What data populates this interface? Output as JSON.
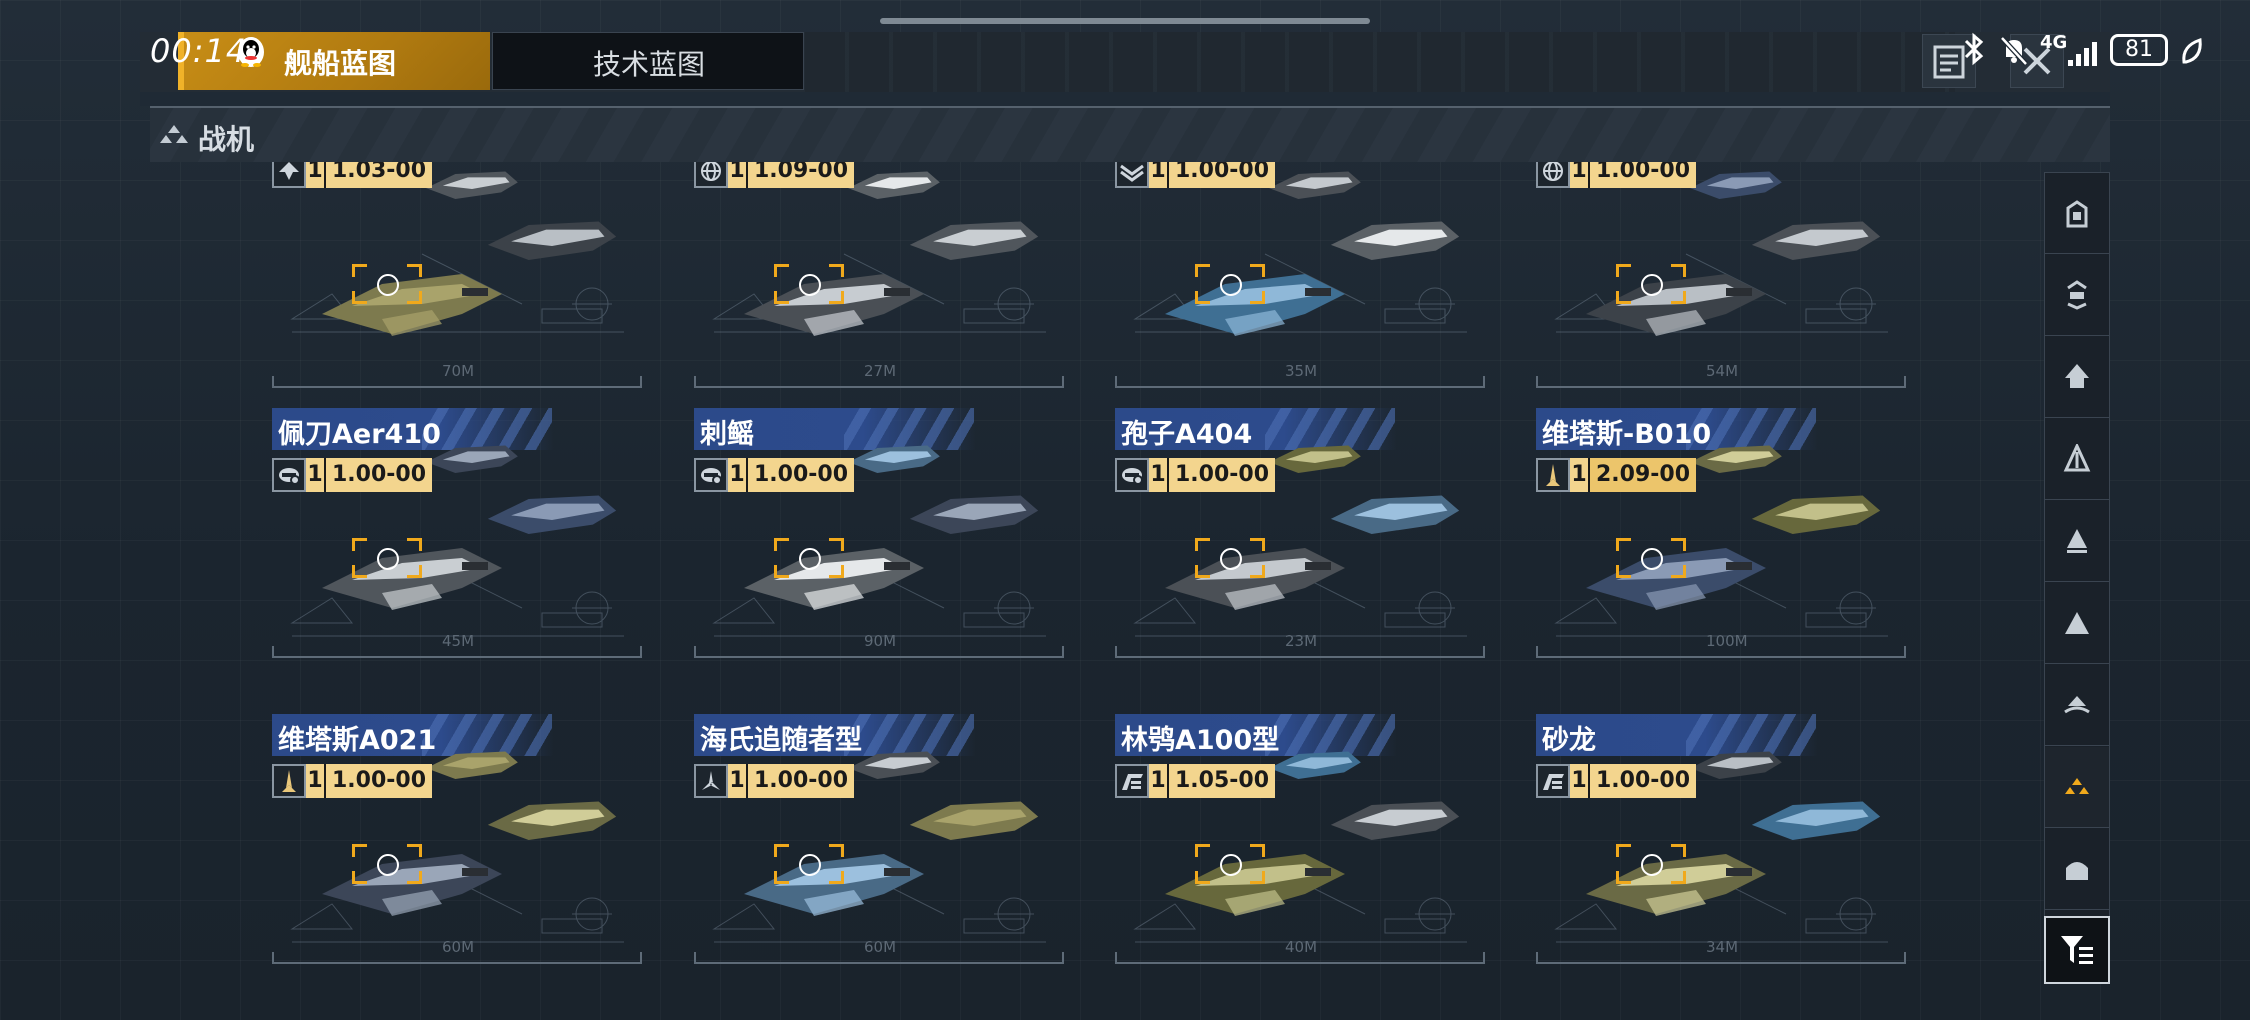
{
  "status": {
    "time": "00:14",
    "network": "4G",
    "battery": "81"
  },
  "tabs": {
    "ship_blueprint": "舰船蓝图",
    "tech_blueprint": "技术蓝图"
  },
  "category": {
    "label": "战机"
  },
  "colors": {
    "accent_gold": "#f0b229",
    "title_blue": "#2c4a8a",
    "filter_active": "#f0a91c"
  },
  "cards_row1": [
    {
      "tier": "1",
      "version": "1.03-00",
      "size": "70M",
      "icon": "bomber-class-icon"
    },
    {
      "tier": "1",
      "version": "1.09-00",
      "size": "27M",
      "icon": "globe-icon"
    },
    {
      "tier": "1",
      "version": "1.00-00",
      "size": "35M",
      "icon": "wing-emblem-icon"
    },
    {
      "tier": "1",
      "version": "1.00-00",
      "size": "54M",
      "icon": "globe-icon"
    }
  ],
  "cards_row2": [
    {
      "name": "佩刀Aer410",
      "tier": "1",
      "version": "1.00-00",
      "size": "45M",
      "icon": "hull-class-icon"
    },
    {
      "name": "刺鳐",
      "tier": "1",
      "version": "1.00-00",
      "size": "90M",
      "icon": "hull-class-icon"
    },
    {
      "name": "孢子A404",
      "tier": "1",
      "version": "1.00-00",
      "size": "23M",
      "icon": "hull-class-icon"
    },
    {
      "name": "维塔斯-B010",
      "tier": "1",
      "version": "2.09-00",
      "size": "100M",
      "icon": "dart-icon"
    }
  ],
  "cards_row3": [
    {
      "name": "维塔斯A021",
      "tier": "1",
      "version": "1.00-00",
      "size": "60M",
      "icon": "dart-icon"
    },
    {
      "name": "海氏追随者型",
      "tier": "1",
      "version": "1.00-00",
      "size": "60M",
      "icon": "tri-blade-icon"
    },
    {
      "name": "林鸮A100型",
      "tier": "1",
      "version": "1.05-00",
      "size": "40M",
      "icon": "swept-wing-icon"
    },
    {
      "name": "砂龙",
      "tier": "1",
      "version": "1.00-00",
      "size": "34M",
      "icon": "swept-wing-icon"
    }
  ],
  "sidebar": {
    "items": [
      "carrier-class-icon",
      "battlecruiser-class-icon",
      "cruiser-class-icon",
      "destroyer-class-icon",
      "frigate-class-icon",
      "corvette-class-icon",
      "auxiliary-class-icon",
      "fighter-class-icon",
      "hangar-class-icon"
    ],
    "active_index": 7
  }
}
